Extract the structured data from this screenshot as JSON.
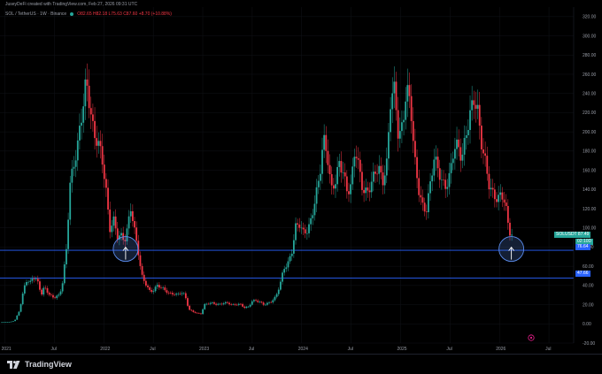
{
  "header": {
    "creator": "JuseyDeFi created with TradingView.com, Feb 27, 2026 09:31 UTC",
    "symbol_line": "SOL / TetherUS · 1W · Binance",
    "ohlc": "O82.65 H82.18 L75.63 C87.60 +8.70 (+10.88%)"
  },
  "colors": {
    "background": "#000000",
    "up": "#26a69a",
    "down": "#f23645",
    "support_line": "#2962ff",
    "circle": "#5b8def",
    "grid": "#111318"
  },
  "price_tags": {
    "symbol": "SOLUSDT",
    "last": "87.49",
    "countdown": "02:10D",
    "support_high": "76.64",
    "support_low": "47.66"
  },
  "footer": {
    "brand": "TradingView"
  },
  "chart_data": {
    "type": "candlestick",
    "symbol": "SOL / TetherUS",
    "interval": "1W",
    "exchange": "Binance",
    "ylim": [
      -20,
      330
    ],
    "y_ticks": [
      "320.00",
      "300.00",
      "280.00",
      "260.00",
      "240.00",
      "220.00",
      "200.00",
      "180.00",
      "160.00",
      "140.00",
      "120.00",
      "100.00",
      "80.00",
      "60.00",
      "40.00",
      "20.00",
      "0.00",
      "-20.00"
    ],
    "x_ticks": [
      {
        "label": "2021",
        "t": 2021.0
      },
      {
        "label": "Jul",
        "t": 2021.5
      },
      {
        "label": "2022",
        "t": 2022.0
      },
      {
        "label": "Jul",
        "t": 2022.5
      },
      {
        "label": "2023",
        "t": 2023.0
      },
      {
        "label": "Jul",
        "t": 2023.5
      },
      {
        "label": "2024",
        "t": 2024.0
      },
      {
        "label": "Jul",
        "t": 2024.5
      },
      {
        "label": "2025",
        "t": 2025.0
      },
      {
        "label": "Jul",
        "t": 2025.5
      },
      {
        "label": "2026",
        "t": 2026.0
      },
      {
        "label": "Jul",
        "t": 2026.5
      }
    ],
    "support_levels": [
      76.64,
      47.66
    ],
    "highlights": [
      {
        "t": 2022.22,
        "price": 78
      },
      {
        "t": 2026.12,
        "price": 78
      }
    ],
    "anchors": [
      [
        2020.95,
        1.5
      ],
      [
        2021.05,
        2
      ],
      [
        2021.1,
        3.5
      ],
      [
        2021.15,
        15
      ],
      [
        2021.18,
        30
      ],
      [
        2021.21,
        45
      ],
      [
        2021.25,
        42
      ],
      [
        2021.28,
        50
      ],
      [
        2021.33,
        45
      ],
      [
        2021.37,
        30
      ],
      [
        2021.4,
        38
      ],
      [
        2021.45,
        30
      ],
      [
        2021.5,
        28
      ],
      [
        2021.55,
        30
      ],
      [
        2021.58,
        40
      ],
      [
        2021.62,
        75
      ],
      [
        2021.66,
        150
      ],
      [
        2021.7,
        170
      ],
      [
        2021.74,
        190
      ],
      [
        2021.78,
        215
      ],
      [
        2021.82,
        250
      ],
      [
        2021.86,
        230
      ],
      [
        2021.9,
        200
      ],
      [
        2021.94,
        190
      ],
      [
        2021.98,
        170
      ],
      [
        2022.02,
        140
      ],
      [
        2022.06,
        100
      ],
      [
        2022.1,
        110
      ],
      [
        2022.14,
        90
      ],
      [
        2022.18,
        90
      ],
      [
        2022.21,
        85
      ],
      [
        2022.24,
        100
      ],
      [
        2022.27,
        125
      ],
      [
        2022.3,
        105
      ],
      [
        2022.34,
        80
      ],
      [
        2022.38,
        50
      ],
      [
        2022.42,
        42
      ],
      [
        2022.46,
        35
      ],
      [
        2022.5,
        35
      ],
      [
        2022.54,
        40
      ],
      [
        2022.58,
        37
      ],
      [
        2022.62,
        35
      ],
      [
        2022.66,
        32
      ],
      [
        2022.7,
        32
      ],
      [
        2022.74,
        30
      ],
      [
        2022.78,
        32
      ],
      [
        2022.82,
        30
      ],
      [
        2022.86,
        15
      ],
      [
        2022.9,
        13
      ],
      [
        2022.94,
        11
      ],
      [
        2022.98,
        10
      ],
      [
        2023.02,
        20
      ],
      [
        2023.06,
        22
      ],
      [
        2023.1,
        22
      ],
      [
        2023.14,
        20
      ],
      [
        2023.18,
        20
      ],
      [
        2023.22,
        22
      ],
      [
        2023.26,
        22
      ],
      [
        2023.3,
        20
      ],
      [
        2023.34,
        20
      ],
      [
        2023.38,
        20
      ],
      [
        2023.42,
        17
      ],
      [
        2023.46,
        18
      ],
      [
        2023.5,
        24
      ],
      [
        2023.54,
        24
      ],
      [
        2023.58,
        22
      ],
      [
        2023.62,
        20
      ],
      [
        2023.66,
        22
      ],
      [
        2023.7,
        24
      ],
      [
        2023.74,
        28
      ],
      [
        2023.78,
        40
      ],
      [
        2023.82,
        58
      ],
      [
        2023.86,
        64
      ],
      [
        2023.9,
        75
      ],
      [
        2023.94,
        100
      ],
      [
        2023.98,
        102
      ],
      [
        2024.02,
        95
      ],
      [
        2024.06,
        100
      ],
      [
        2024.1,
        110
      ],
      [
        2024.14,
        130
      ],
      [
        2024.18,
        150
      ],
      [
        2024.22,
        195
      ],
      [
        2024.26,
        180
      ],
      [
        2024.3,
        140
      ],
      [
        2024.34,
        145
      ],
      [
        2024.38,
        165
      ],
      [
        2024.42,
        160
      ],
      [
        2024.46,
        140
      ],
      [
        2024.5,
        145
      ],
      [
        2024.54,
        180
      ],
      [
        2024.58,
        160
      ],
      [
        2024.62,
        140
      ],
      [
        2024.66,
        140
      ],
      [
        2024.7,
        145
      ],
      [
        2024.74,
        155
      ],
      [
        2024.78,
        160
      ],
      [
        2024.82,
        150
      ],
      [
        2024.86,
        170
      ],
      [
        2024.9,
        235
      ],
      [
        2024.94,
        240
      ],
      [
        2024.98,
        190
      ],
      [
        2025.02,
        210
      ],
      [
        2025.06,
        250
      ],
      [
        2025.1,
        230
      ],
      [
        2025.14,
        170
      ],
      [
        2025.18,
        140
      ],
      [
        2025.22,
        125
      ],
      [
        2025.26,
        120
      ],
      [
        2025.3,
        145
      ],
      [
        2025.34,
        170
      ],
      [
        2025.38,
        160
      ],
      [
        2025.42,
        150
      ],
      [
        2025.46,
        145
      ],
      [
        2025.5,
        155
      ],
      [
        2025.54,
        180
      ],
      [
        2025.58,
        185
      ],
      [
        2025.62,
        175
      ],
      [
        2025.66,
        200
      ],
      [
        2025.7,
        215
      ],
      [
        2025.74,
        230
      ],
      [
        2025.78,
        220
      ],
      [
        2025.82,
        190
      ],
      [
        2025.86,
        170
      ],
      [
        2025.9,
        140
      ],
      [
        2025.94,
        132
      ],
      [
        2025.98,
        128
      ],
      [
        2026.02,
        140
      ],
      [
        2026.06,
        125
      ],
      [
        2026.1,
        95
      ],
      [
        2026.14,
        87
      ]
    ]
  }
}
